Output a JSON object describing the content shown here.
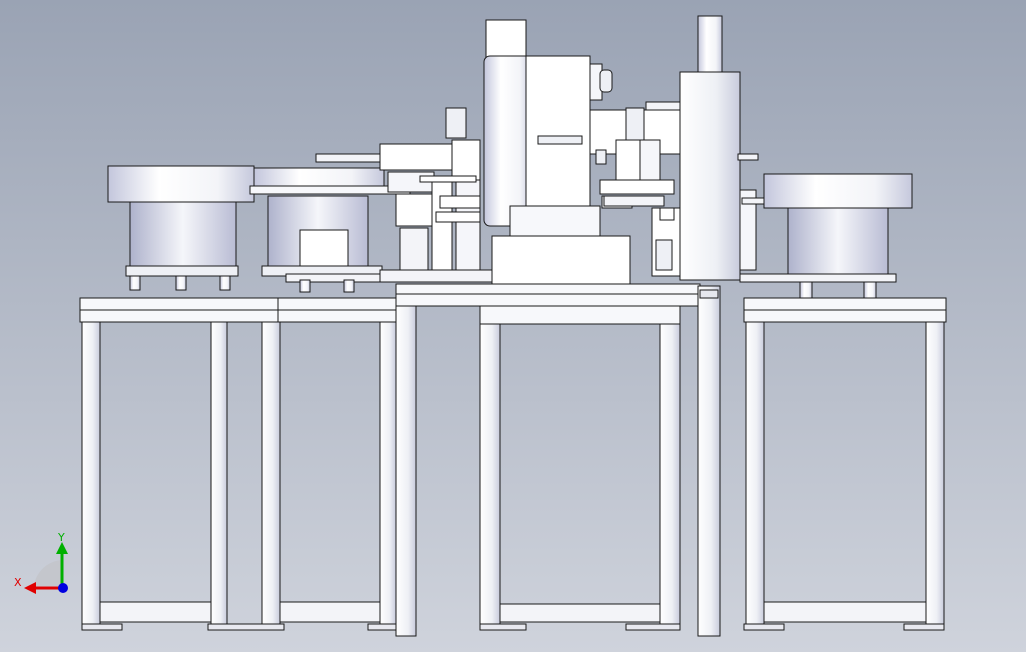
{
  "viewport": {
    "background_top": "#9aa3b4",
    "background_bottom": "#cfd3dc",
    "part_fill": "#ffffff",
    "edge_color": "#1a1a1a",
    "shade_color": "#c9ccdd"
  },
  "triad": {
    "x_label": "X",
    "y_label": "Y",
    "x_color": "#e00000",
    "y_color": "#00b000",
    "z_color": "#0000e0"
  }
}
